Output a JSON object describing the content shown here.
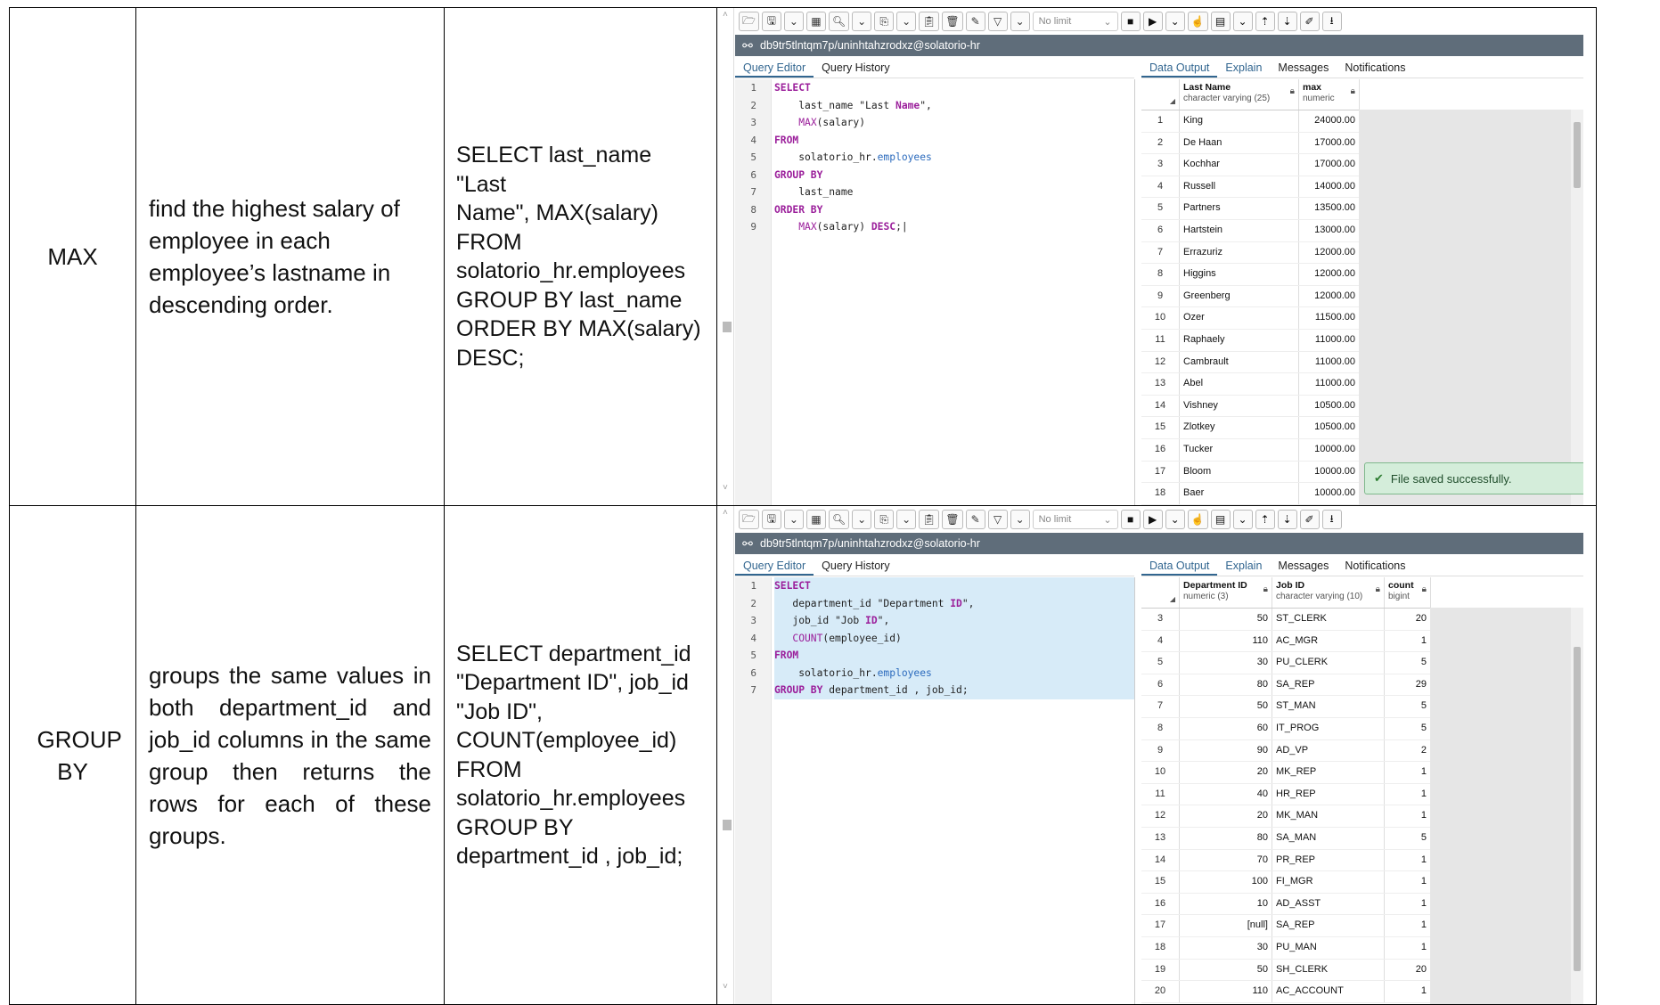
{
  "rows": [
    {
      "function": "MAX",
      "description": "find the highest salary of employee in each employee’s lastname in descending order.",
      "query_lines": [
        "SELECT last_name \"Last",
        "Name\", MAX(salary)",
        "FROM",
        "solatorio_hr.employees",
        "GROUP BY last_name",
        "ORDER BY MAX(salary)",
        "DESC;"
      ],
      "panel": {
        "no_limit": "No limit",
        "connection": "db9tr5tlntqm7p/uninhtahzrodxz@solatorio-hr",
        "left_tabs": [
          "Query Editor",
          "Query History"
        ],
        "right_tabs": [
          "Data Output",
          "Explain",
          "Messages",
          "Notifications"
        ],
        "line_numbers": [
          "1",
          "2",
          "3",
          "4",
          "5",
          "6",
          "7",
          "8",
          "9"
        ],
        "columns": [
          {
            "name": "Last Name",
            "type": "character varying (25)"
          },
          {
            "name": "max",
            "type": "numeric"
          }
        ],
        "result_rows": [
          [
            "1",
            "King",
            "24000.00"
          ],
          [
            "2",
            "De Haan",
            "17000.00"
          ],
          [
            "3",
            "Kochhar",
            "17000.00"
          ],
          [
            "4",
            "Russell",
            "14000.00"
          ],
          [
            "5",
            "Partners",
            "13500.00"
          ],
          [
            "6",
            "Hartstein",
            "13000.00"
          ],
          [
            "7",
            "Errazuriz",
            "12000.00"
          ],
          [
            "8",
            "Higgins",
            "12000.00"
          ],
          [
            "9",
            "Greenberg",
            "12000.00"
          ],
          [
            "10",
            "Ozer",
            "11500.00"
          ],
          [
            "11",
            "Raphaely",
            "11000.00"
          ],
          [
            "12",
            "Cambrault",
            "11000.00"
          ],
          [
            "13",
            "Abel",
            "11000.00"
          ],
          [
            "14",
            "Vishney",
            "10500.00"
          ],
          [
            "15",
            "Zlotkey",
            "10500.00"
          ],
          [
            "16",
            "Tucker",
            "10000.00"
          ],
          [
            "17",
            "Bloom",
            "10000.00"
          ],
          [
            "18",
            "Baer",
            "10000.00"
          ]
        ],
        "toast": "File saved successfully."
      }
    },
    {
      "function": "GROUP BY",
      "description": "groups the same values in both department_id and job_id columns in the same group then returns the rows for each of these groups.",
      "query_lines": [
        "SELECT department_id",
        "\"Department ID\", job_id",
        "\"Job ID\",",
        "COUNT(employee_id)",
        "FROM",
        "solatorio_hr.employees",
        "GROUP BY",
        "department_id , job_id;"
      ],
      "panel": {
        "no_limit": "No limit",
        "connection": "db9tr5tlntqm7p/uninhtahzrodxz@solatorio-hr",
        "left_tabs": [
          "Query Editor",
          "Query History"
        ],
        "right_tabs": [
          "Data Output",
          "Explain",
          "Messages",
          "Notifications"
        ],
        "line_numbers": [
          "1",
          "2",
          "3",
          "4",
          "5",
          "6",
          "7"
        ],
        "columns": [
          {
            "name": "Department ID",
            "type": "numeric (3)"
          },
          {
            "name": "Job ID",
            "type": "character varying (10)"
          },
          {
            "name": "count",
            "type": "bigint"
          }
        ],
        "result_rows": [
          [
            "3",
            "50",
            "ST_CLERK",
            "20"
          ],
          [
            "4",
            "110",
            "AC_MGR",
            "1"
          ],
          [
            "5",
            "30",
            "PU_CLERK",
            "5"
          ],
          [
            "6",
            "80",
            "SA_REP",
            "29"
          ],
          [
            "7",
            "50",
            "ST_MAN",
            "5"
          ],
          [
            "8",
            "60",
            "IT_PROG",
            "5"
          ],
          [
            "9",
            "90",
            "AD_VP",
            "2"
          ],
          [
            "10",
            "20",
            "MK_REP",
            "1"
          ],
          [
            "11",
            "40",
            "HR_REP",
            "1"
          ],
          [
            "12",
            "20",
            "MK_MAN",
            "1"
          ],
          [
            "13",
            "80",
            "SA_MAN",
            "5"
          ],
          [
            "14",
            "70",
            "PR_REP",
            "1"
          ],
          [
            "15",
            "100",
            "FI_MGR",
            "1"
          ],
          [
            "16",
            "10",
            "AD_ASST",
            "1"
          ],
          [
            "17",
            "[null]",
            "SA_REP",
            "1"
          ],
          [
            "18",
            "30",
            "PU_MAN",
            "1"
          ],
          [
            "19",
            "50",
            "SH_CLERK",
            "20"
          ],
          [
            "20",
            "110",
            "AC_ACCOUNT",
            "1"
          ]
        ]
      }
    }
  ]
}
